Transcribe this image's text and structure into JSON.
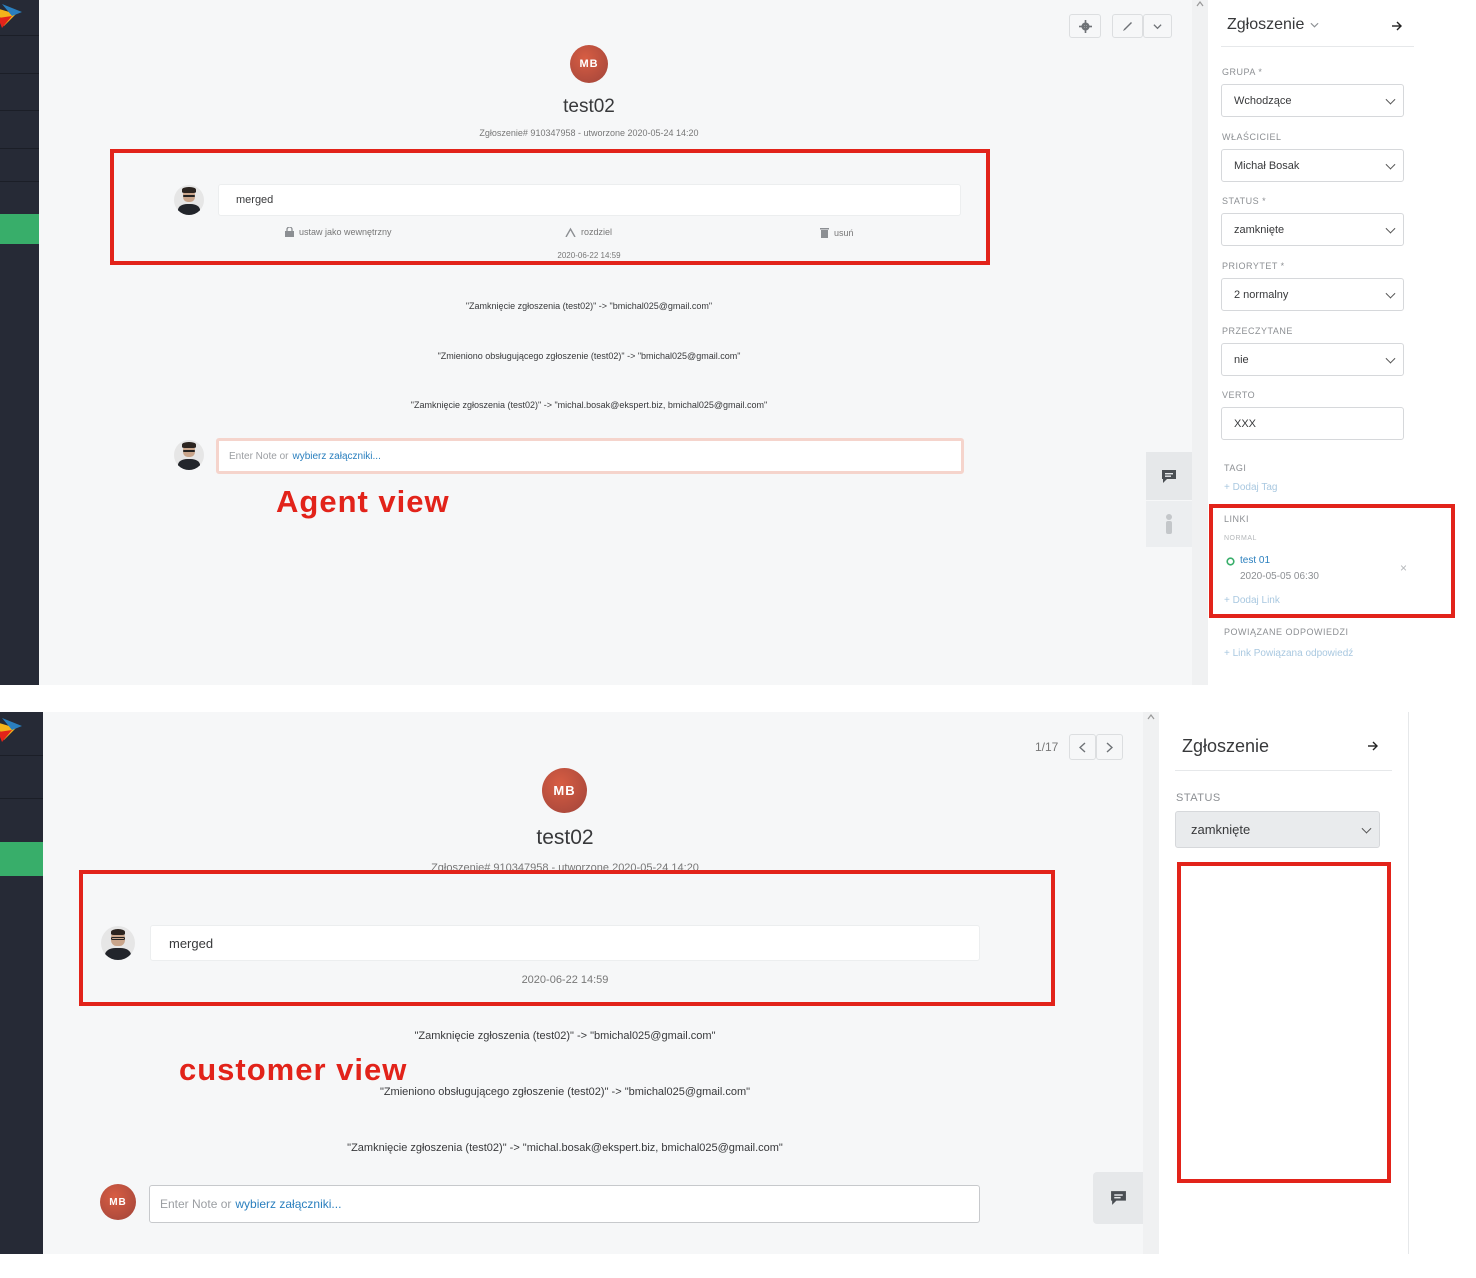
{
  "agent_view": {
    "avatar_initials": "MB",
    "ticket_title": "test02",
    "ticket_meta": "Zgłoszenie# 910347958 - utworzone 2020-05-24 14:20",
    "article": {
      "text": "merged",
      "actions": [
        "ustaw jako wewnętrzny",
        "rozdziel",
        "usuń"
      ],
      "timestamp": "2020-06-22 14:59"
    },
    "history": [
      "\"Zamknięcie zgłoszenia (test02)\" -> \"bmichal025@gmail.com\"",
      "\"Zmieniono obsługującego zgłoszenie (test02)\" -> \"bmichal025@gmail.com\"",
      "\"Zamknięcie zgłoszenia (test02)\" -> \"michal.bosak@ekspert.biz, bmichal025@gmail.com\""
    ],
    "note": {
      "placeholder": "Enter Note or",
      "link": "wybierz załączniki..."
    },
    "label": "Agent view",
    "sidebar": {
      "title": "Zgłoszenie",
      "fields": [
        {
          "label": "GRUPA *",
          "value": "Wchodzące",
          "type": "select"
        },
        {
          "label": "WŁAŚCICIEL",
          "value": "Michał Bosak",
          "type": "select"
        },
        {
          "label": "STATUS *",
          "value": "zamknięte",
          "type": "select"
        },
        {
          "label": "PRIORYTET *",
          "value": "2 normalny",
          "type": "select"
        },
        {
          "label": "PRZECZYTANE",
          "value": "nie",
          "type": "select"
        },
        {
          "label": "VERTO",
          "value": "XXX",
          "type": "text"
        }
      ],
      "tags": {
        "label": "TAGI",
        "add": "+ Dodaj Tag"
      },
      "links": {
        "label": "LINKI",
        "group": "NORMAL",
        "item_title": "test 01",
        "item_date": "2020-05-05 06:30",
        "add": "+ Dodaj Link"
      },
      "related": {
        "label": "POWIĄZANE ODPOWIEDZI",
        "add": "+ Link Powiązana odpowiedź"
      }
    }
  },
  "customer_view": {
    "pagination": "1/17",
    "avatar_initials": "MB",
    "ticket_title": "test02",
    "ticket_meta": "Zgłoszenie# 910347958 - utworzone 2020-05-24 14:20",
    "article": {
      "text": "merged",
      "timestamp": "2020-06-22 14:59"
    },
    "history": [
      "\"Zamknięcie zgłoszenia (test02)\" -> \"bmichal025@gmail.com\"",
      "\"Zmieniono obsługującego zgłoszenie (test02)\" -> \"bmichal025@gmail.com\"",
      "\"Zamknięcie zgłoszenia (test02)\" -> \"michal.bosak@ekspert.biz, bmichal025@gmail.com\""
    ],
    "note": {
      "avatar_initials": "MB",
      "placeholder": "Enter Note or",
      "link": "wybierz załączniki..."
    },
    "label": "customer view",
    "sidebar": {
      "title": "Zgłoszenie",
      "status_label": "STATUS",
      "status_value": "zamknięte"
    }
  },
  "colors": {
    "accent_red": "#e2231a",
    "nav_bg": "#262a36",
    "nav_active": "#38ae6a",
    "link_blue": "#2a7fbe",
    "avatar": "#c0503d"
  }
}
